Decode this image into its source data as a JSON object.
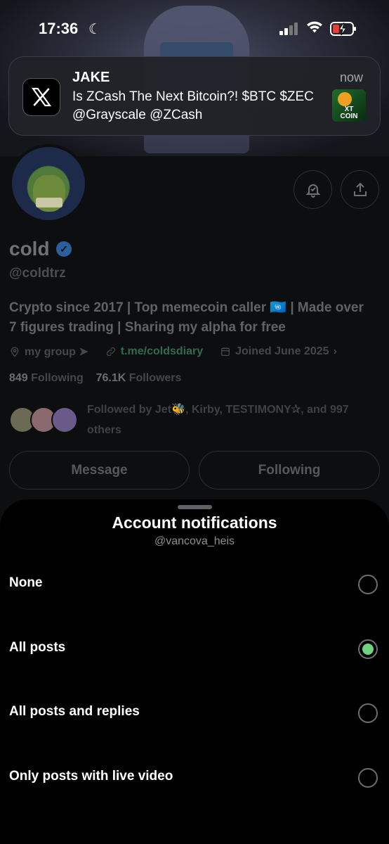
{
  "status_bar": {
    "time": "17:36",
    "moon_icon": "☾"
  },
  "notification": {
    "app_icon": "x-logo-icon",
    "app_glyph": "X",
    "title": "JAKE",
    "time": "now",
    "body": "Is ZCash The Next Bitcoin?! $BTC $ZEC @Grayscale @ZCash",
    "thumb_text": "XT\nCOIN"
  },
  "profile": {
    "name": "cold",
    "verified_glyph": "✓",
    "handle": "@coldtrz",
    "bio": "Crypto since 2017 | Top memecoin caller 🇺🇳 | Made over 7 figures trading | Sharing my alpha for free",
    "location": "my group ➤",
    "link": "t.me/coldsdiary",
    "joined": "Joined June 2025",
    "following_count": "849",
    "following_label": "Following",
    "followers_count": "76.1K",
    "followers_label": "Followers",
    "followed_by": "Followed by Jet🐝, Kirby, TESTIMONY✰, and 997 others",
    "message_button": "Message",
    "following_button": "Following"
  },
  "sheet": {
    "title": "Account notifications",
    "subtitle": "@vancova_heis",
    "options": [
      {
        "label": "None",
        "selected": false
      },
      {
        "label": "All posts",
        "selected": true
      },
      {
        "label": "All posts and replies",
        "selected": false
      },
      {
        "label": "Only posts with live video",
        "selected": false
      }
    ]
  },
  "colors": {
    "accent_green": "#6fd27e",
    "verified_blue": "#2b5f9e"
  }
}
